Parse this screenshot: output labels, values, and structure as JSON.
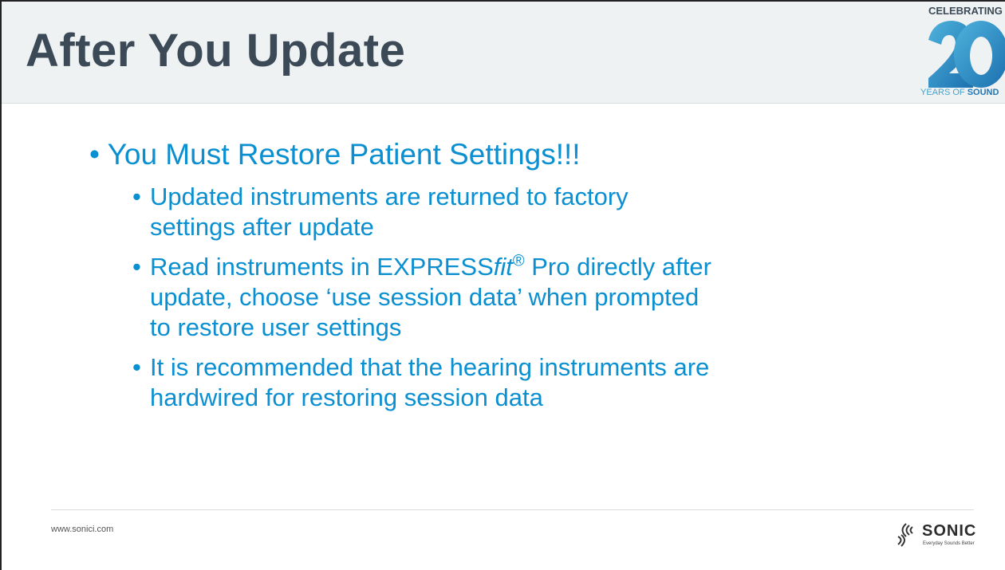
{
  "header": {
    "title": "After You Update",
    "badge": {
      "top": "CELEBRATING",
      "number": "20",
      "bottom_light": "YEARS OF ",
      "bottom_bold": "SOUND"
    }
  },
  "content": {
    "heading": "You Must Restore Patient Settings!!!",
    "items": [
      {
        "lines": [
          "Updated instruments are returned to factory",
          "settings after update"
        ]
      },
      {
        "line1_pre": "Read instruments in EXPRESS",
        "line1_italic": "fit",
        "line1_reg": "®",
        "line1_post": " Pro directly after",
        "lines_rest": [
          "update, choose ‘use session data’ when prompted",
          "to restore user settings"
        ]
      },
      {
        "lines": [
          "It is recommended that the hearing instruments are",
          "hardwired for restoring session data"
        ]
      }
    ]
  },
  "footer": {
    "url": "www.sonici.com",
    "brand": "SONIC",
    "tagline": "Everyday Sounds Better"
  },
  "colors": {
    "title": "#3b4a56",
    "bullet_text": "#0a8fd1",
    "badge_accent": "#2176b5",
    "header_band": "#eff2f3"
  }
}
